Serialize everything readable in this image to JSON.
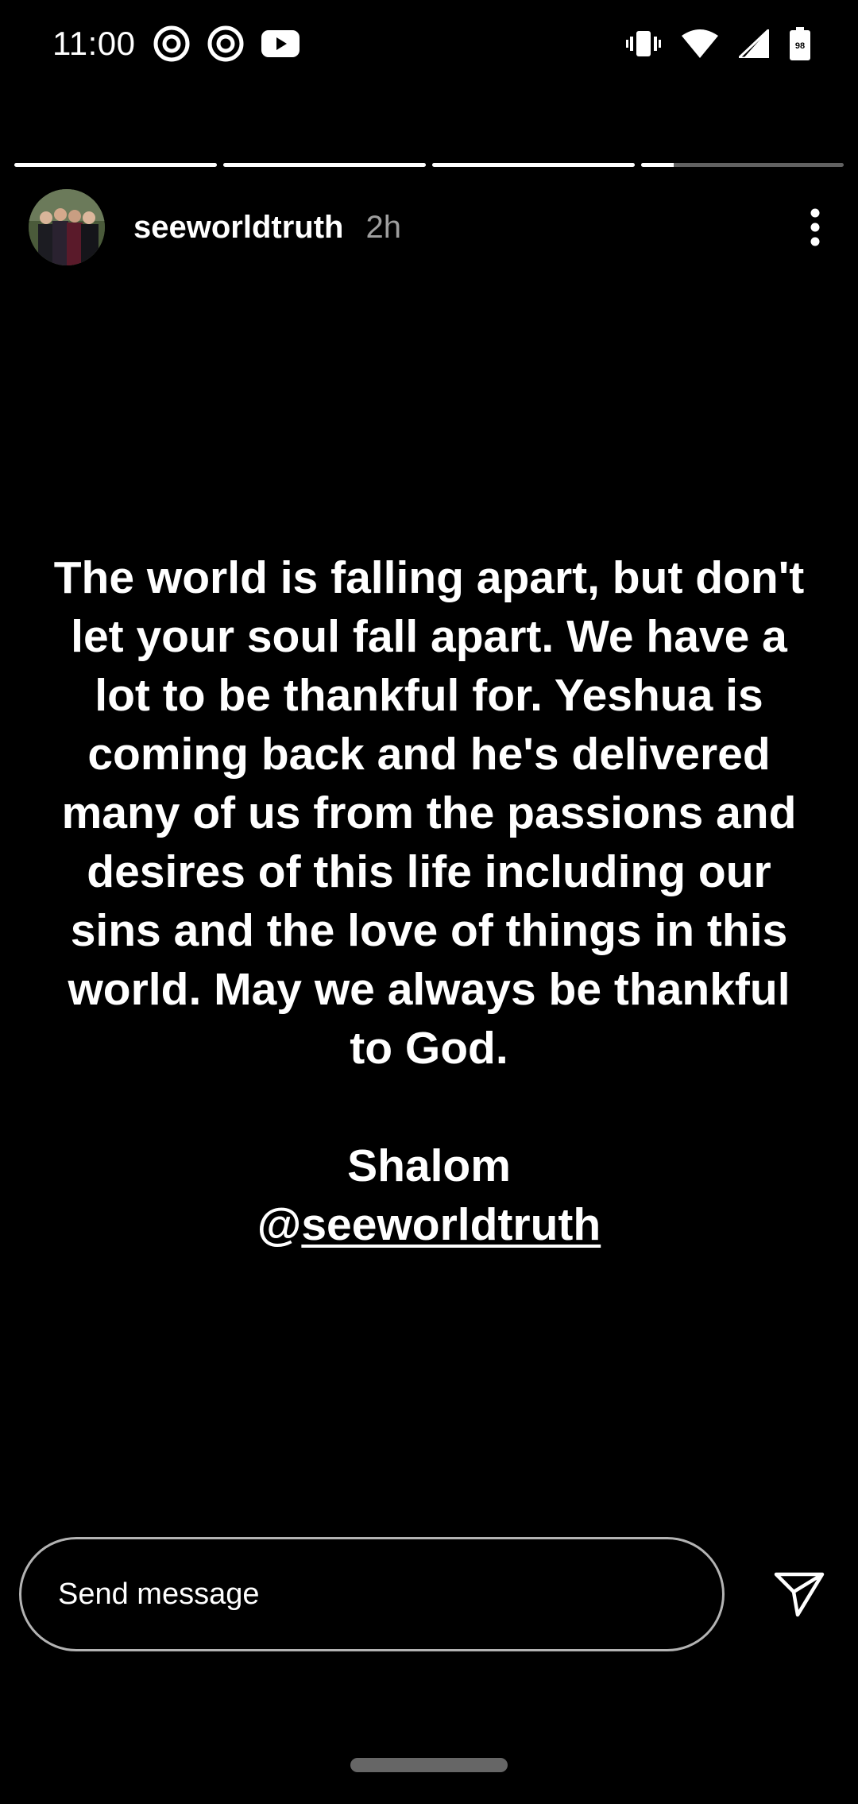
{
  "status_bar": {
    "time": "11:00",
    "battery_level": "98",
    "left_icons": [
      "threads-icon",
      "threads-icon",
      "youtube-icon"
    ],
    "right_icons": [
      "vibrate-icon",
      "wifi-icon",
      "signal-icon",
      "battery-icon"
    ]
  },
  "progress": {
    "segments": [
      1,
      1,
      1,
      0.16
    ]
  },
  "header": {
    "username": "seeworldtruth",
    "time_ago": "2h"
  },
  "story": {
    "text": "The world is falling apart, but don't let your soul fall apart. We have a lot to be thankful for. Yeshua is coming back and he's delivered many of us from the passions and desires of this life including our sins and the love of things in this world. May we always be thankful to God.",
    "signoff": "Shalom",
    "mention_at": "@",
    "mention_handle": "seeworldtruth"
  },
  "reply": {
    "placeholder": "Send message"
  }
}
